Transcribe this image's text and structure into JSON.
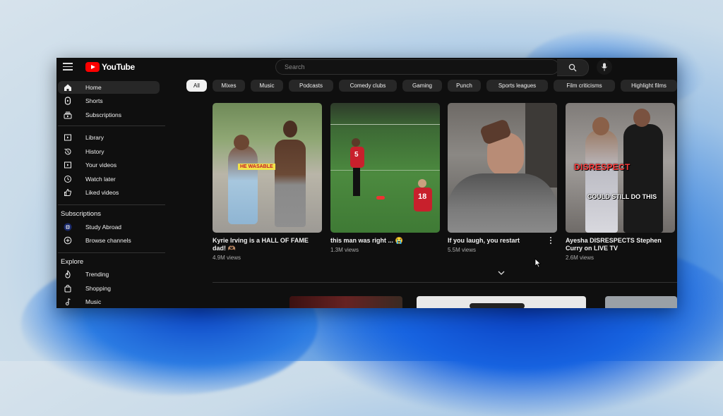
{
  "app": {
    "logo_text": "YouTube",
    "brand_color": "#ff0000"
  },
  "search": {
    "placeholder": "Search"
  },
  "sidebar": {
    "items": [
      {
        "label": "Home",
        "icon": "home-icon",
        "active": true
      },
      {
        "label": "Shorts",
        "icon": "shorts-icon"
      },
      {
        "label": "Subscriptions",
        "icon": "subscriptions-icon"
      },
      {
        "label": "Library",
        "icon": "library-icon"
      },
      {
        "label": "History",
        "icon": "history-icon"
      },
      {
        "label": "Your videos",
        "icon": "your-videos-icon"
      },
      {
        "label": "Watch later",
        "icon": "clock-icon"
      },
      {
        "label": "Liked videos",
        "icon": "thumbs-up-icon"
      }
    ],
    "subscriptions_title": "Subscriptions",
    "subscriptions": [
      {
        "label": "Study Abroad",
        "icon": "channel-avatar-icon"
      },
      {
        "label": "Browse channels",
        "icon": "plus-circle-icon"
      }
    ],
    "explore_title": "Explore",
    "explore": [
      {
        "label": "Trending",
        "icon": "fire-icon"
      },
      {
        "label": "Shopping",
        "icon": "bag-icon"
      },
      {
        "label": "Music",
        "icon": "music-note-icon"
      }
    ]
  },
  "chips": [
    "All",
    "Mixes",
    "Music",
    "Podcasts",
    "Comedy clubs",
    "Gaming",
    "Punch",
    "Sports leagues",
    "Film criticisms",
    "Highlight films"
  ],
  "videos": [
    {
      "title": "Kyrie Irving is a HALL OF FAME dad! 🫶🏽",
      "views": "4.9M views",
      "overlay": "HE WASABLE"
    },
    {
      "title": "this man was right ... 😭",
      "views": "1.3M views",
      "overlay": ""
    },
    {
      "title": "If you laugh, you restart",
      "views": "5.5M views",
      "overlay": ""
    },
    {
      "title": "Ayesha DISRESPECTS Stephen Curry on LIVE TV",
      "views": "2.6M views",
      "overlay": "DISRESPECT",
      "overlay2": "COULD STILL DO THIS"
    }
  ]
}
